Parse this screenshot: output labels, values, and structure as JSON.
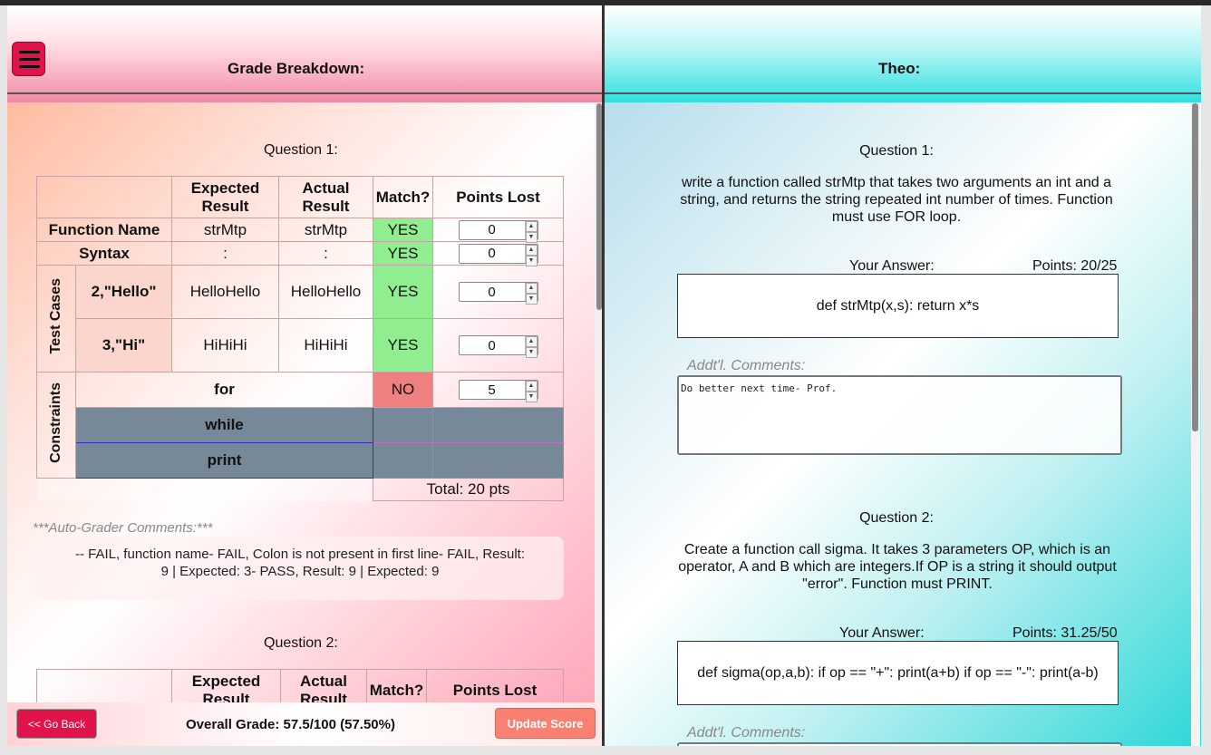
{
  "left": {
    "header_title": "Grade Breakdown:",
    "question1_title": "Question 1:",
    "question2_title": "Question 2:",
    "table": {
      "headers": {
        "expected": "Expected Result",
        "actual": "Actual Result",
        "match": "Match?",
        "points_lost": "Points Lost"
      },
      "rows": {
        "function_name": {
          "label": "Function Name",
          "expected": "strMtp",
          "actual": "strMtp",
          "match": "YES",
          "points": "0"
        },
        "syntax": {
          "label": "Syntax",
          "expected": ":",
          "actual": ":",
          "match": "YES",
          "points": "0"
        },
        "test_cases_label": "Test Cases",
        "test1": {
          "label": "2,\"Hello\"",
          "expected": "HelloHello",
          "actual": "HelloHello",
          "match": "YES",
          "points": "0"
        },
        "test2": {
          "label": "3,\"Hi\"",
          "expected": "HiHiHi",
          "actual": "HiHiHi",
          "match": "YES",
          "points": "0"
        },
        "constraints_label": "Constraints",
        "c_for": {
          "label": "for",
          "match": "NO",
          "points": "5"
        },
        "c_while": {
          "label": "while"
        },
        "c_print": {
          "label": "print"
        }
      },
      "total": "Total: 20 pts"
    },
    "auto_label": "***Auto-Grader Comments:***",
    "auto_comments": "-- FAIL, function name- FAIL, Colon is not present in first line- FAIL, Result: 9 | Expected: 3- PASS, Result: 9 | Expected: 9",
    "table2_headers": {
      "expected": "Expected Result",
      "actual": "Actual Result",
      "match": "Match?",
      "points_lost": "Points Lost"
    }
  },
  "footer": {
    "back_label": "<< Go Back",
    "overall": "Overall Grade: 57.5/100 (57.50%)",
    "update_label": "Update Score"
  },
  "right": {
    "header_title": "Theo:",
    "q1": {
      "title": "Question 1:",
      "prompt": "write a function called strMtp that takes two arguments an int and a string, and returns the string repeated int number of times. Function must use FOR loop.",
      "your_answer_label": "Your Answer:",
      "points": "Points: 20/25",
      "answer": "def strMtp(x,s): return x*s",
      "comments_label": "Addt'l. Comments:",
      "comments": "Do better next time- Prof."
    },
    "q2": {
      "title": "Question 2:",
      "prompt": "Create a function call sigma. It takes 3 parameters OP, which is an operator, A and B which are integers.If OP is a string it should output \"error\". Function must PRINT.",
      "your_answer_label": "Your Answer:",
      "points": "Points: 31.25/50",
      "answer": "def sigma(op,a,b): if op == \"+\": print(a+b) if op == \"-\": print(a-b)",
      "comments_label": "Addt'l. Comments:"
    }
  },
  "colors": {
    "match_yes": "#90ee90",
    "match_no": "#f08080",
    "disabled_row": "#778899",
    "primary_button": "#e0144a",
    "update_button": "#fa8072"
  },
  "icons": {
    "menu": "hamburger-menu-icon",
    "spinner": "number-spinner-icon"
  }
}
